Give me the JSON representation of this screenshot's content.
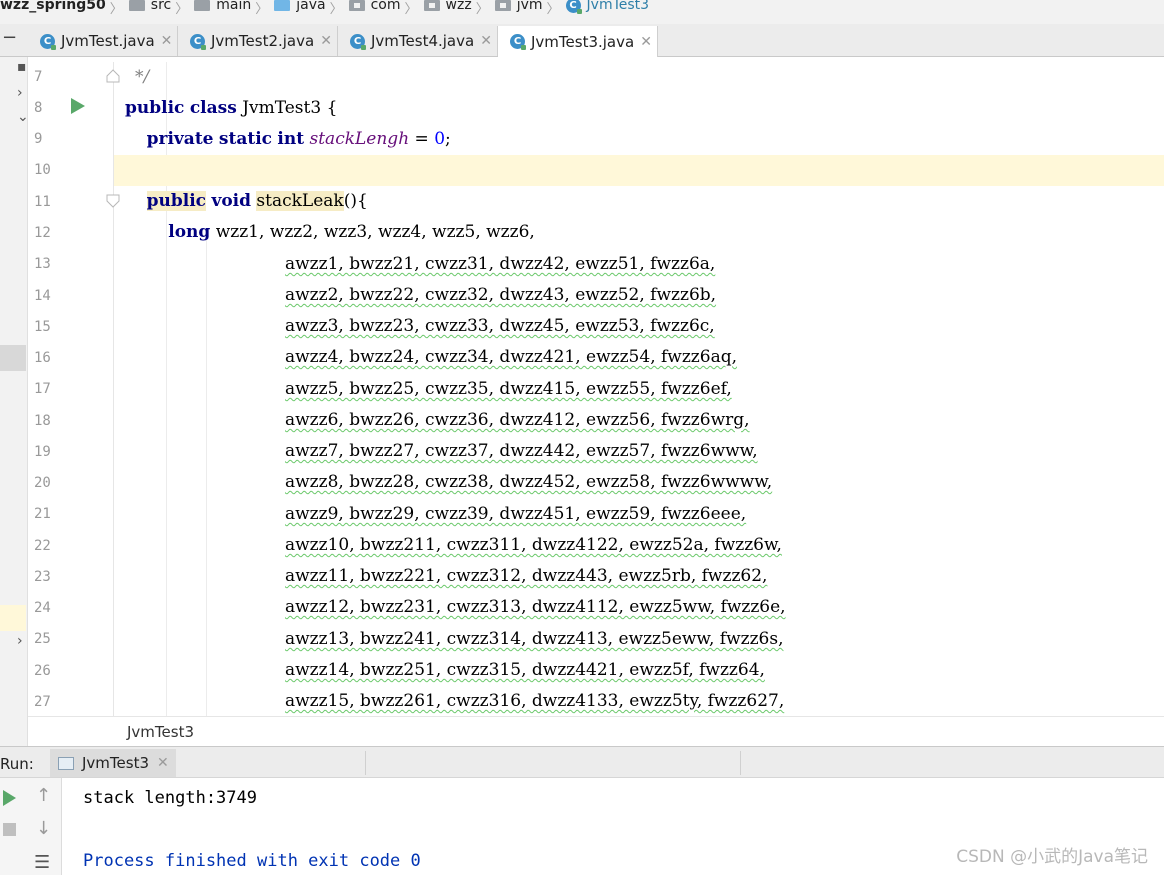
{
  "breadcrumb": {
    "project": "wzz_spring50",
    "items": [
      "src",
      "main",
      "java",
      "com",
      "wzz",
      "jvm"
    ],
    "class_name": "JvmTest3"
  },
  "tabs": [
    {
      "label": "JvmTest.java",
      "active": false
    },
    {
      "label": "JvmTest2.java",
      "active": false
    },
    {
      "label": "JvmTest4.java",
      "active": false
    },
    {
      "label": "JvmTest3.java",
      "active": true
    }
  ],
  "editor": {
    "line_numbers": [
      "7",
      "8",
      "9",
      "10",
      "11",
      "12",
      "13",
      "14",
      "15",
      "16",
      "17",
      "18",
      "19",
      "20",
      "21",
      "22",
      "23",
      "24",
      "25",
      "26",
      "27"
    ],
    "line7": "*/",
    "line8": {
      "kw1": "public",
      "kw2": "class",
      "name": "JvmTest3 {"
    },
    "line9": {
      "kw1": "private",
      "kw2": "static",
      "kw3": "int",
      "field": "stackLengh",
      "assign": " = ",
      "value": "0",
      "end": ";"
    },
    "line11": {
      "kw1": "public",
      "kw2": "void",
      "method": "stackLeak",
      "end": "(){"
    },
    "line12": {
      "kw": "long",
      "rest": "wzz1, wzz2, wzz3, wzz4, wzz5, wzz6,"
    },
    "var_lines": [
      "awzz1, bwzz21, cwzz31, dwzz42, ewzz51, fwzz6a,",
      "awzz2, bwzz22, cwzz32, dwzz43, ewzz52, fwzz6b,",
      "awzz3, bwzz23, cwzz33, dwzz45, ewzz53, fwzz6c,",
      "awzz4, bwzz24, cwzz34, dwzz421, ewzz54, fwzz6aq,",
      "awzz5, bwzz25, cwzz35, dwzz415, ewzz55, fwzz6ef,",
      "awzz6, bwzz26, cwzz36, dwzz412, ewzz56, fwzz6wrg,",
      "awzz7, bwzz27, cwzz37, dwzz442, ewzz57, fwzz6www,",
      "awzz8, bwzz28, cwzz38, dwzz452, ewzz58, fwzz6wwww,",
      "awzz9, bwzz29, cwzz39, dwzz451, ewzz59, fwzz6eee,",
      "awzz10, bwzz211, cwzz311, dwzz4122, ewzz52a, fwzz6w,",
      "awzz11, bwzz221, cwzz312, dwzz443, ewzz5rb, fwzz62,",
      "awzz12, bwzz231, cwzz313, dwzz4112, ewzz5ww, fwzz6e,",
      "awzz13, bwzz241, cwzz314, dwzz413, ewzz5eww, fwzz6s,",
      "awzz14, bwzz251, cwzz315, dwzz4421, ewzz5f, fwzz64,",
      "awzz15, bwzz261, cwzz316, dwzz4133, ewzz5ty, fwzz627,"
    ]
  },
  "structure_label": "JvmTest3",
  "run": {
    "label": "Run:",
    "tab_label": "JvmTest3",
    "output_line": "stack length:3749",
    "exit_line": "Process finished with exit code 0"
  },
  "watermark": "CSDN @小武的Java笔记",
  "colors": {
    "keyword": "#000080",
    "field": "#660e7a",
    "number": "#0000ff",
    "current_line": "#fff8d9",
    "run_green": "#59a869",
    "exit_text": "#0033b3"
  }
}
